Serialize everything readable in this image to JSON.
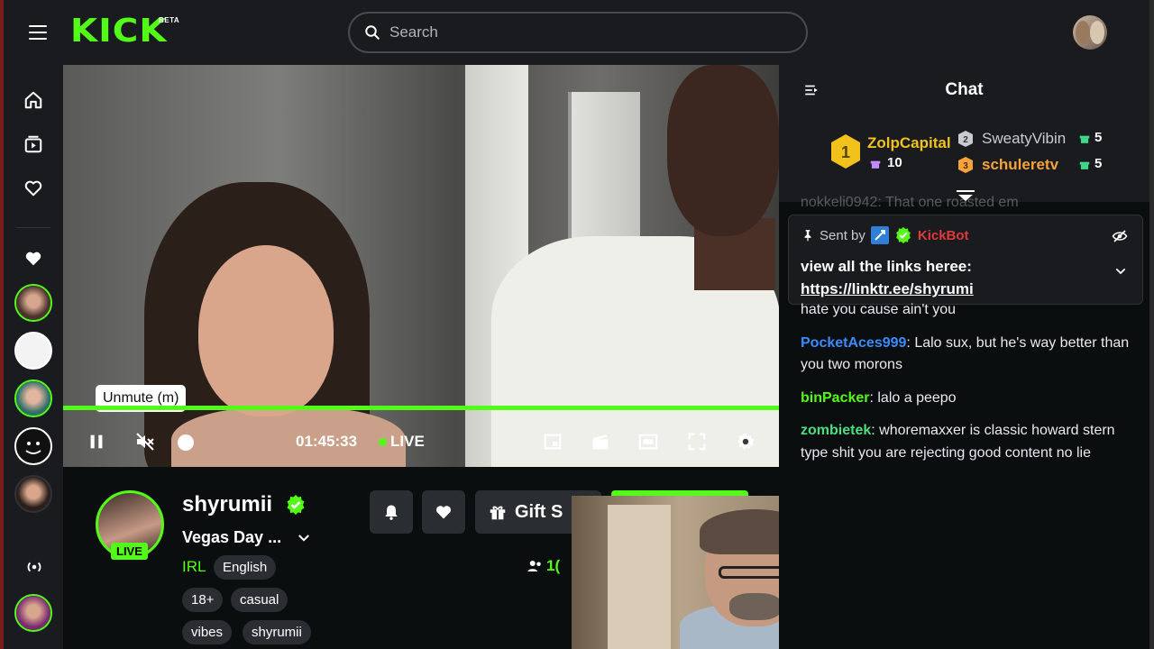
{
  "topbar": {
    "logo": "KICK",
    "logo_badge": "BETA",
    "search_placeholder": "Search"
  },
  "video": {
    "tooltip": "Unmute (m)",
    "time": "01:45:33",
    "live_label": "LIVE",
    "progress": 1.0
  },
  "channel": {
    "name": "shyrumii",
    "title": "Vegas Day ...",
    "category": "IRL",
    "live_badge": "LIVE",
    "tags": [
      "English",
      "18+",
      "casual",
      "vibes",
      "shyrumii"
    ],
    "gift_label": "Gift S",
    "viewers": "1("
  },
  "chat": {
    "title": "Chat",
    "leaderboard": [
      {
        "rank": "1",
        "name": "ZolpCapital",
        "count": "10",
        "color": "#f1c21b"
      },
      {
        "rank": "2",
        "name": "SweatyVibin",
        "count": "5",
        "color": "#c8cbd0"
      },
      {
        "rank": "3",
        "name": "schuleretv",
        "count": "5",
        "color": "#f7a23b"
      }
    ],
    "faded_line": "nokkeli0942: That one roasted em",
    "pinned": {
      "sent_by_label": "Sent by",
      "sender": "KickBot",
      "message": "view all the links heree:",
      "link": "https://linktr.ee/shyrumi"
    },
    "messages": [
      {
        "user": "",
        "color": "#ffffff",
        "text": "hate you cause ain't you"
      },
      {
        "user": "PocketAces999",
        "color": "#3b8bff",
        "text": "Lalo sux, but he's way better than you two morons"
      },
      {
        "user": "binPacker",
        "color": "#53fc18",
        "text": "lalo a peepo"
      },
      {
        "user": "zombietek",
        "color": "#4ade80",
        "text": "whoremaxxer is classic howard stern type shit you are rejecting good content no lie"
      }
    ]
  },
  "colors": {
    "accent": "#53fc18",
    "panel": "#191b1f",
    "background": "#0b0e0f",
    "kickbot": "#e03a3a"
  }
}
